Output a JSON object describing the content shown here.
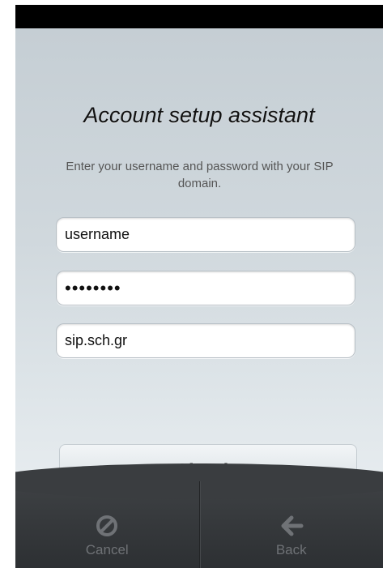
{
  "assistant": {
    "title": "Account setup assistant",
    "instructions": "Enter your username and password with your SIP domain."
  },
  "form": {
    "username": {
      "value": "username"
    },
    "password": {
      "value": "••••••••"
    },
    "domain": {
      "value": "sip.sch.gr"
    },
    "sign_in_label": "Sign in"
  },
  "tabbar": {
    "items": [
      {
        "label": "Cancel",
        "icon": "cancel-icon"
      },
      {
        "label": "Back",
        "icon": "back-arrow-icon"
      }
    ]
  },
  "colors": {
    "background_top": "#c5ced4",
    "background_bottom": "#e8edf0",
    "tabbar": "#2d3033",
    "tab_text": "#6f7276"
  }
}
